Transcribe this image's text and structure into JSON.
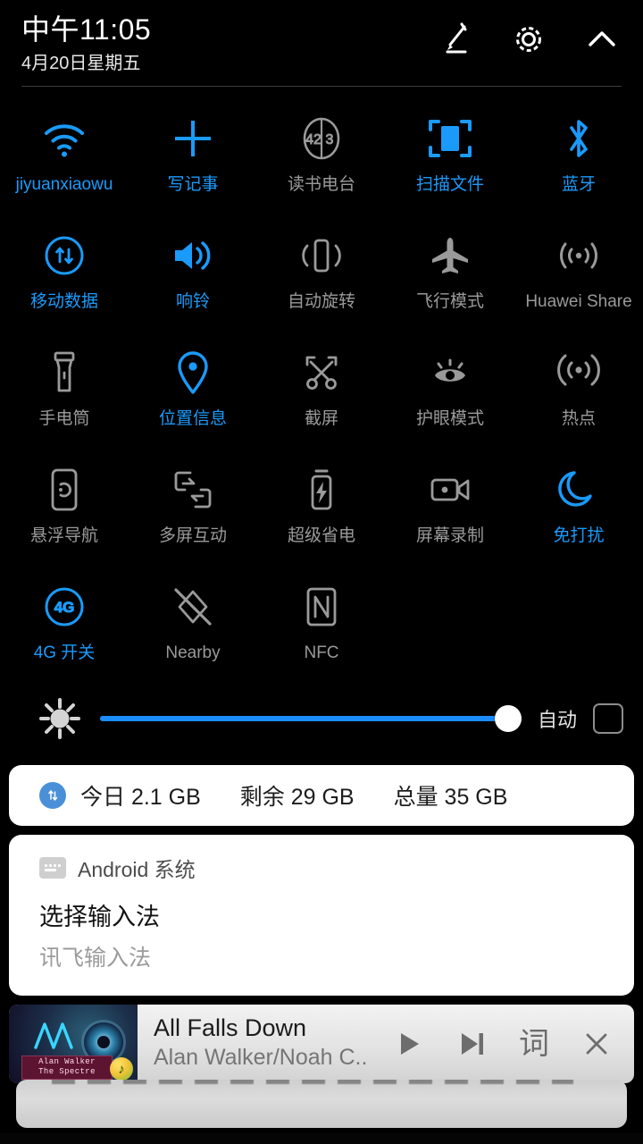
{
  "statusbar": {
    "time": "中午11:05",
    "date": "4月20日星期五",
    "icons": {
      "edit": "pencil-icon",
      "settings": "gear-icon",
      "collapse": "chevron-up-icon"
    }
  },
  "accent_color": "#1a9bfc",
  "inactive_color": "#9a9a9a",
  "tiles": [
    [
      {
        "label": "jiyuanxiaowu",
        "icon": "wifi-icon",
        "active": true
      },
      {
        "label": "写记事",
        "icon": "plus-icon",
        "active": true
      },
      {
        "label": "读书电台",
        "icon": "radio-423-icon",
        "active": false,
        "badge_left": "42",
        "badge_right": "3"
      },
      {
        "label": "扫描文件",
        "icon": "scan-document-icon",
        "active": true
      },
      {
        "label": "蓝牙",
        "icon": "bluetooth-icon",
        "active": true
      }
    ],
    [
      {
        "label": "移动数据",
        "icon": "mobile-data-icon",
        "active": true
      },
      {
        "label": "响铃",
        "icon": "ringer-volume-icon",
        "active": true
      },
      {
        "label": "自动旋转",
        "icon": "auto-rotate-icon",
        "active": false
      },
      {
        "label": "飞行模式",
        "icon": "airplane-icon",
        "active": false
      },
      {
        "label": "Huawei Share",
        "icon": "huawei-share-icon",
        "active": false
      }
    ],
    [
      {
        "label": "手电筒",
        "icon": "flashlight-icon",
        "active": false
      },
      {
        "label": "位置信息",
        "icon": "location-pin-icon",
        "active": true
      },
      {
        "label": "截屏",
        "icon": "screenshot-scissors-icon",
        "active": false
      },
      {
        "label": "护眼模式",
        "icon": "eye-comfort-icon",
        "active": false
      },
      {
        "label": "热点",
        "icon": "hotspot-icon",
        "active": false
      }
    ],
    [
      {
        "label": "悬浮导航",
        "icon": "floating-nav-icon",
        "active": false
      },
      {
        "label": "多屏互动",
        "icon": "multi-screen-icon",
        "active": false
      },
      {
        "label": "超级省电",
        "icon": "ultra-power-saving-icon",
        "active": false
      },
      {
        "label": "屏幕录制",
        "icon": "screen-record-icon",
        "active": false
      },
      {
        "label": "免打扰",
        "icon": "do-not-disturb-moon-icon",
        "active": true
      }
    ],
    [
      {
        "label": "4G 开关",
        "icon": "4g-toggle-icon",
        "active": true,
        "badge": "4G"
      },
      {
        "label": "Nearby",
        "icon": "nearby-off-icon",
        "active": false
      },
      {
        "label": "NFC",
        "icon": "nfc-icon",
        "active": false
      }
    ]
  ],
  "brightness": {
    "icon": "brightness-sun-icon",
    "value": 100,
    "auto_label": "自动",
    "auto_checked": false
  },
  "data_card": {
    "icon": "mobile-data-icon",
    "today": "今日 2.1 GB",
    "remaining": "剩余 29 GB",
    "total": "总量 35 GB"
  },
  "notification": {
    "app_icon": "keyboard-icon",
    "app_name": "Android 系统",
    "title": "选择输入法",
    "subtitle": "讯飞输入法"
  },
  "music": {
    "album_line1": "Alan Walker",
    "album_line2": "The Spectre",
    "badge": "♪",
    "aw_logo": "alan-walker-logo",
    "title": "All Falls Down",
    "artist": "Alan Walker/Noah C..",
    "controls": {
      "play": "play-icon",
      "next": "next-track-icon",
      "lyrics": "词",
      "close": "close-icon"
    }
  }
}
